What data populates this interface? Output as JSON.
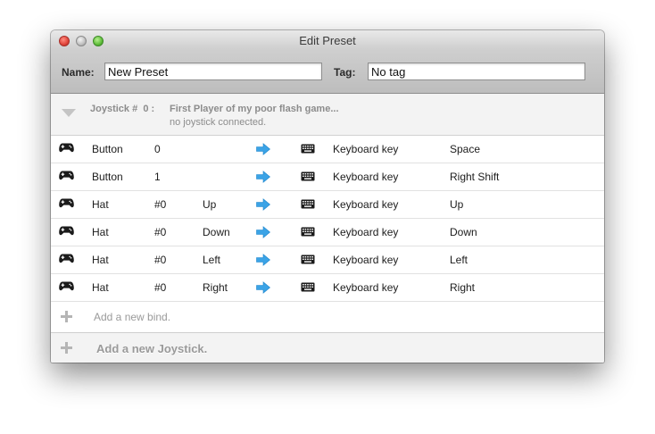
{
  "window": {
    "title": "Edit Preset"
  },
  "form": {
    "name_label": "Name:",
    "name_value": "New Preset",
    "tag_label": "Tag:",
    "tag_value": "No tag"
  },
  "joystick": {
    "id_label": "Joystick #  0 :",
    "name": "First Player of my poor flash game...",
    "status": "no joystick connected."
  },
  "binds": [
    {
      "type": "Button",
      "index": "0",
      "direction": "",
      "key_type": "Keyboard key",
      "key": "Space"
    },
    {
      "type": "Button",
      "index": "1",
      "direction": "",
      "key_type": "Keyboard key",
      "key": "Right Shift"
    },
    {
      "type": "Hat",
      "index": "#0",
      "direction": "Up",
      "key_type": "Keyboard key",
      "key": "Up"
    },
    {
      "type": "Hat",
      "index": "#0",
      "direction": "Down",
      "key_type": "Keyboard key",
      "key": "Down"
    },
    {
      "type": "Hat",
      "index": "#0",
      "direction": "Left",
      "key_type": "Keyboard key",
      "key": "Left"
    },
    {
      "type": "Hat",
      "index": "#0",
      "direction": "Right",
      "key_type": "Keyboard key",
      "key": "Right"
    }
  ],
  "add_bind_label": "Add a new bind.",
  "add_joystick_label": "Add a new Joystick.",
  "icons": {
    "source": "gamepad-icon",
    "mapping": "arrow-right-icon",
    "target": "keyboard-icon",
    "add": "plus-icon",
    "disclosure": "disclosure-triangle-icon"
  },
  "colors": {
    "arrow": "#3ba3e6",
    "muted_text": "#8c8c8c"
  }
}
